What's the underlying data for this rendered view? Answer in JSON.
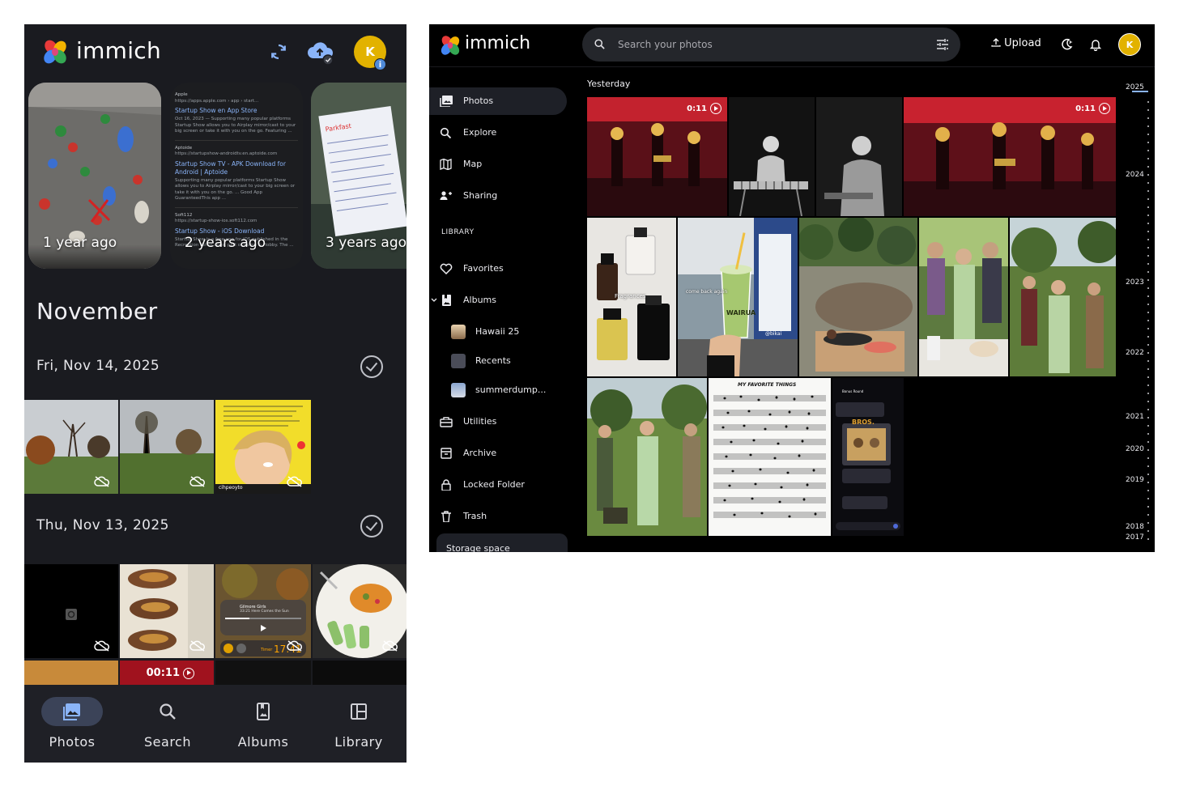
{
  "mobile": {
    "app_name": "immich",
    "header": {
      "avatar_initial": "K",
      "avatar_badge": "i",
      "sync_icon": "sync-icon",
      "backup_icon": "cloud-upload-check-icon"
    },
    "memories": [
      {
        "label": "1 year ago"
      },
      {
        "label": "2 years ago"
      },
      {
        "label": "3 years ago"
      }
    ],
    "memory_card_2_text": {
      "r1_site": "Apple",
      "r1_url": "https://apps.apple.com › app › start...",
      "r1_title": "Startup Show en App Store",
      "r1_body": "Oct 16, 2023 — Supporting many popular platforms Startup Show allows you to Airplay mirror/cast to your big screen or take it with you on the go. Featuring ...",
      "r2_site": "Aptoide",
      "r2_url": "https://startupshow-androidtv.en.aptoide.com",
      "r2_title": "Startup Show TV - APK Download for Android | Aptoide",
      "r2_body": "Supporting many popular platforms Startup Show allows you to Airplay mirror/cast to your big screen or take it with you on the go. ... Good App GuaranteedThis app ...",
      "r3_site": "Soft112",
      "r3_url": "https://startup-show-ios.soft112.com",
      "r3_title": "Startup Show - iOS Download",
      "r3_body": "Startup Show is a free app for iOS published in the Recreation list of apps, part of Home & Hobby. The ..."
    },
    "month": "November",
    "days": [
      {
        "date": "Fri, Nov 14, 2025"
      },
      {
        "date": "Thu, Nov 13, 2025"
      }
    ],
    "thumb_texts": {
      "meme_user": "cihpeoyto",
      "music_title": "Gilmore Girls",
      "music_sub": "33:21 Here Comes the Sun",
      "timer_label": "Timer",
      "timer_value": "17:41",
      "video_duration": "00:11"
    },
    "nav": [
      {
        "label": "Photos",
        "icon": "photos-icon",
        "active": true
      },
      {
        "label": "Search",
        "icon": "search-icon",
        "active": false
      },
      {
        "label": "Albums",
        "icon": "albums-icon",
        "active": false
      },
      {
        "label": "Library",
        "icon": "library-icon",
        "active": false
      }
    ]
  },
  "desktop": {
    "app_name": "immich",
    "search": {
      "placeholder": "Search your photos"
    },
    "upload_label": "Upload",
    "avatar_initial": "K",
    "sidebar": {
      "items": [
        {
          "label": "Photos",
          "icon": "photos-icon",
          "active": true
        },
        {
          "label": "Explore",
          "icon": "search-icon"
        },
        {
          "label": "Map",
          "icon": "map-icon"
        },
        {
          "label": "Sharing",
          "icon": "sharing-icon"
        }
      ],
      "library_heading": "LIBRARY",
      "library_items": [
        {
          "label": "Favorites",
          "icon": "heart-icon"
        },
        {
          "label": "Albums",
          "icon": "albums-icon"
        }
      ],
      "albums": [
        {
          "label": "Hawaii 25"
        },
        {
          "label": "Recents"
        },
        {
          "label": "summerdump..."
        }
      ],
      "more_items": [
        {
          "label": "Utilities",
          "icon": "toolbox-icon"
        },
        {
          "label": "Archive",
          "icon": "archive-icon"
        },
        {
          "label": "Locked Folder",
          "icon": "lock-icon"
        },
        {
          "label": "Trash",
          "icon": "trash-icon"
        }
      ],
      "storage_label": "Storage space"
    },
    "section_title": "Yesterday",
    "video_durations": [
      "0:11",
      "0:11"
    ],
    "photo_texts": {
      "fragrance_caption": "Fragrances",
      "drink_caption": "come back again",
      "drink_brand": "WAIRUA",
      "tiktok_user": "@bikai",
      "sheet_title": "MY FAVORITE THINGS",
      "chat_title": "BROS.",
      "chat_header": "Bonus Round"
    },
    "timeline_years": [
      "2025",
      "2024",
      "2023",
      "2022",
      "2021",
      "2020",
      "2019",
      "2018",
      "2017"
    ]
  },
  "colors": {
    "mobile_bg": "#1a1b20",
    "accent": "#8ab4f8",
    "avatar": "#e2b200",
    "nav_active_pill": "#3b4358"
  }
}
